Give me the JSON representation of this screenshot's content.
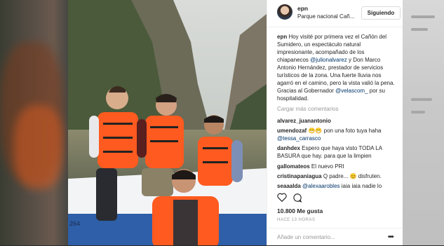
{
  "post": {
    "username": "epn",
    "location": "Parque nacional Cañ...",
    "follow_label": "Siguiendo",
    "caption": {
      "user": "epn",
      "text_1": " Hoy visité por primera vez el Cañón del Sumidero, un espectáculo natural impresionante, acompañado de los chiapanecos ",
      "mention_1": "@julionalvarez",
      "text_2": " y Don Marco Antonio Hernández, prestador de servicios turísticos de la zona. Una fuerte lluvia nos agarró en el camino, pero la vista valió la pena. Gracias al Gobernador ",
      "mention_2": "@velascom_",
      "text_3": " por su hospitalidad."
    },
    "load_more": "Cargar más comentarios",
    "comments": [
      {
        "user": "alvarez_juanantonio",
        "text": ""
      },
      {
        "user": "umendozaf",
        "text": "😁😁 pon una foto tuya haha",
        "mention": "@tessa_carrasco"
      },
      {
        "user": "danhdex",
        "text": "Espero que haya visto TODA LA BASURA que hay. para que la limpien"
      },
      {
        "user": "gallomateos",
        "text": "El nuevo PRI"
      },
      {
        "user": "cristinapaniagua",
        "text": "Q padre... 😊 disfruten."
      },
      {
        "user": "seaaalda",
        "mention": "@alexaarobles",
        "text": "iaia iaia nadie lo"
      }
    ],
    "likes": "10.800 Me gusta",
    "time": "HACE 13 HORAS",
    "comment_placeholder": "Añade un comentario...",
    "more_icon": "ellipsis-icon"
  },
  "colors": {
    "link": "#003569",
    "text": "#262626",
    "muted": "#999999",
    "border": "#efefef",
    "vest": "#ff5a1f"
  }
}
